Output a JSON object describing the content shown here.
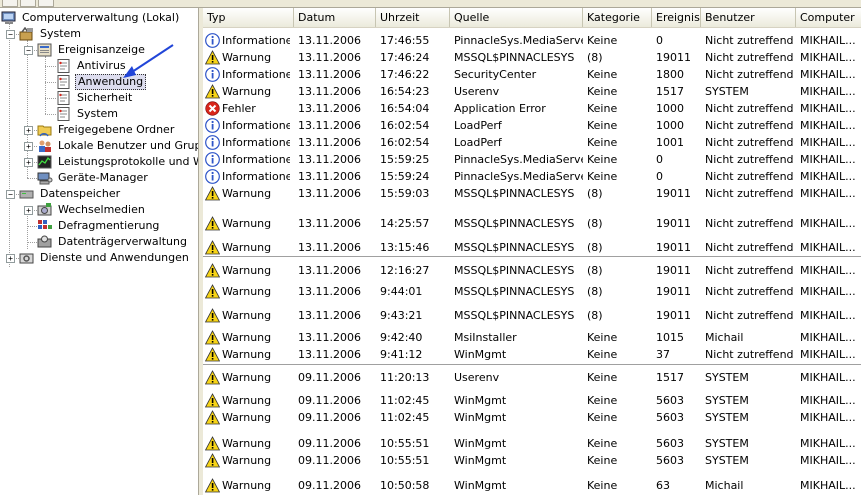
{
  "tree": {
    "root": {
      "label": "Computerverwaltung (Lokal)",
      "icon": "computer-management-icon"
    },
    "items": [
      {
        "label": "System",
        "icon": "system-tools-icon",
        "level": 1,
        "expander": "−"
      },
      {
        "label": "Ereignisanzeige",
        "icon": "event-viewer-icon",
        "level": 2,
        "expander": "−"
      },
      {
        "label": "Antivirus",
        "icon": "log-icon",
        "level": 3,
        "expander": ""
      },
      {
        "label": "Anwendung",
        "icon": "log-icon",
        "level": 3,
        "expander": "",
        "selected": true
      },
      {
        "label": "Sicherheit",
        "icon": "log-icon",
        "level": 3,
        "expander": ""
      },
      {
        "label": "System",
        "icon": "log-icon",
        "level": 3,
        "expander": ""
      },
      {
        "label": "Freigegebene Ordner",
        "icon": "shared-folder-icon",
        "level": 2,
        "expander": "+"
      },
      {
        "label": "Lokale Benutzer und Gruppen",
        "icon": "users-icon",
        "level": 2,
        "expander": "+"
      },
      {
        "label": "Leistungsprotokolle und Warnungen",
        "icon": "performance-icon",
        "level": 2,
        "expander": "+"
      },
      {
        "label": "Geräte-Manager",
        "icon": "device-manager-icon",
        "level": 2,
        "expander": ""
      },
      {
        "label": "Datenspeicher",
        "icon": "storage-icon",
        "level": 1,
        "expander": "−"
      },
      {
        "label": "Wechselmedien",
        "icon": "removable-media-icon",
        "level": 2,
        "expander": "+"
      },
      {
        "label": "Defragmentierung",
        "icon": "defrag-icon",
        "level": 2,
        "expander": ""
      },
      {
        "label": "Datenträgerverwaltung",
        "icon": "disk-management-icon",
        "level": 2,
        "expander": ""
      },
      {
        "label": "Dienste und Anwendungen",
        "icon": "services-icon",
        "level": 1,
        "expander": "+"
      }
    ]
  },
  "list": {
    "columns": [
      "Typ",
      "Datum",
      "Uhrzeit",
      "Quelle",
      "Kategorie",
      "Ereignis",
      "Benutzer",
      "Computer"
    ],
    "rows": [
      {
        "type": "info",
        "typ": "Informationen",
        "datum": "13.11.2006",
        "uhrzeit": "17:46:55",
        "quelle": "PinnacleSys.MediaServer",
        "kategorie": "Keine",
        "ereignis": "0",
        "benutzer": "Nicht zutreffend",
        "computer": "MIKHAIL..."
      },
      {
        "type": "warn",
        "typ": "Warnung",
        "datum": "13.11.2006",
        "uhrzeit": "17:46:24",
        "quelle": "MSSQL$PINNACLESYS",
        "kategorie": "(8)",
        "ereignis": "19011",
        "benutzer": "Nicht zutreffend",
        "computer": "MIKHAIL..."
      },
      {
        "type": "info",
        "typ": "Informationen",
        "datum": "13.11.2006",
        "uhrzeit": "17:46:22",
        "quelle": "SecurityCenter",
        "kategorie": "Keine",
        "ereignis": "1800",
        "benutzer": "Nicht zutreffend",
        "computer": "MIKHAIL..."
      },
      {
        "type": "warn",
        "typ": "Warnung",
        "datum": "13.11.2006",
        "uhrzeit": "16:54:23",
        "quelle": "Userenv",
        "kategorie": "Keine",
        "ereignis": "1517",
        "benutzer": "SYSTEM",
        "computer": "MIKHAIL..."
      },
      {
        "type": "error",
        "typ": "Fehler",
        "datum": "13.11.2006",
        "uhrzeit": "16:54:04",
        "quelle": "Application Error",
        "kategorie": "Keine",
        "ereignis": "1000",
        "benutzer": "Nicht zutreffend",
        "computer": "MIKHAIL..."
      },
      {
        "type": "info",
        "typ": "Informationen",
        "datum": "13.11.2006",
        "uhrzeit": "16:02:54",
        "quelle": "LoadPerf",
        "kategorie": "Keine",
        "ereignis": "1000",
        "benutzer": "Nicht zutreffend",
        "computer": "MIKHAIL..."
      },
      {
        "type": "info",
        "typ": "Informationen",
        "datum": "13.11.2006",
        "uhrzeit": "16:02:54",
        "quelle": "LoadPerf",
        "kategorie": "Keine",
        "ereignis": "1001",
        "benutzer": "Nicht zutreffend",
        "computer": "MIKHAIL..."
      },
      {
        "type": "info",
        "typ": "Informationen",
        "datum": "13.11.2006",
        "uhrzeit": "15:59:25",
        "quelle": "PinnacleSys.MediaServer",
        "kategorie": "Keine",
        "ereignis": "0",
        "benutzer": "Nicht zutreffend",
        "computer": "MIKHAIL..."
      },
      {
        "type": "info",
        "typ": "Informationen",
        "datum": "13.11.2006",
        "uhrzeit": "15:59:24",
        "quelle": "PinnacleSys.MediaServer",
        "kategorie": "Keine",
        "ereignis": "0",
        "benutzer": "Nicht zutreffend",
        "computer": "MIKHAIL..."
      },
      {
        "type": "warn",
        "typ": "Warnung",
        "datum": "13.11.2006",
        "uhrzeit": "15:59:03",
        "quelle": "MSSQL$PINNACLESYS",
        "kategorie": "(8)",
        "ereignis": "19011",
        "benutzer": "Nicht zutreffend",
        "computer": "MIKHAIL..."
      },
      {
        "type": "warn",
        "typ": "Warnung",
        "datum": "13.11.2006",
        "uhrzeit": "14:25:57",
        "quelle": "MSSQL$PINNACLESYS",
        "kategorie": "(8)",
        "ereignis": "19011",
        "benutzer": "Nicht zutreffend",
        "computer": "MIKHAIL..."
      },
      {
        "type": "warn",
        "typ": "Warnung",
        "datum": "13.11.2006",
        "uhrzeit": "13:15:46",
        "quelle": "MSSQL$PINNACLESYS",
        "kategorie": "(8)",
        "ereignis": "19011",
        "benutzer": "Nicht zutreffend",
        "computer": "MIKHAIL..."
      },
      {
        "type": "warn",
        "typ": "Warnung",
        "datum": "13.11.2006",
        "uhrzeit": "12:16:27",
        "quelle": "MSSQL$PINNACLESYS",
        "kategorie": "(8)",
        "ereignis": "19011",
        "benutzer": "Nicht zutreffend",
        "computer": "MIKHAIL..."
      },
      {
        "type": "warn",
        "typ": "Warnung",
        "datum": "13.11.2006",
        "uhrzeit": "9:44:01",
        "quelle": "MSSQL$PINNACLESYS",
        "kategorie": "(8)",
        "ereignis": "19011",
        "benutzer": "Nicht zutreffend",
        "computer": "MIKHAIL..."
      },
      {
        "type": "warn",
        "typ": "Warnung",
        "datum": "13.11.2006",
        "uhrzeit": "9:43:21",
        "quelle": "MSSQL$PINNACLESYS",
        "kategorie": "(8)",
        "ereignis": "19011",
        "benutzer": "Nicht zutreffend",
        "computer": "MIKHAIL..."
      },
      {
        "type": "warn",
        "typ": "Warnung",
        "datum": "13.11.2006",
        "uhrzeit": "9:42:40",
        "quelle": "MsiInstaller",
        "kategorie": "Keine",
        "ereignis": "1015",
        "benutzer": "Michail",
        "computer": "MIKHAIL..."
      },
      {
        "type": "warn",
        "typ": "Warnung",
        "datum": "13.11.2006",
        "uhrzeit": "9:41:12",
        "quelle": "WinMgmt",
        "kategorie": "Keine",
        "ereignis": "37",
        "benutzer": "Nicht zutreffend",
        "computer": "MIKHAIL..."
      },
      {
        "type": "warn",
        "typ": "Warnung",
        "datum": "09.11.2006",
        "uhrzeit": "11:20:13",
        "quelle": "Userenv",
        "kategorie": "Keine",
        "ereignis": "1517",
        "benutzer": "SYSTEM",
        "computer": "MIKHAIL..."
      },
      {
        "type": "warn",
        "typ": "Warnung",
        "datum": "09.11.2006",
        "uhrzeit": "11:02:45",
        "quelle": "WinMgmt",
        "kategorie": "Keine",
        "ereignis": "5603",
        "benutzer": "SYSTEM",
        "computer": "MIKHAIL..."
      },
      {
        "type": "warn",
        "typ": "Warnung",
        "datum": "09.11.2006",
        "uhrzeit": "11:02:45",
        "quelle": "WinMgmt",
        "kategorie": "Keine",
        "ereignis": "5603",
        "benutzer": "SYSTEM",
        "computer": "MIKHAIL..."
      },
      {
        "type": "warn",
        "typ": "Warnung",
        "datum": "09.11.2006",
        "uhrzeit": "10:55:51",
        "quelle": "WinMgmt",
        "kategorie": "Keine",
        "ereignis": "5603",
        "benutzer": "SYSTEM",
        "computer": "MIKHAIL..."
      },
      {
        "type": "warn",
        "typ": "Warnung",
        "datum": "09.11.2006",
        "uhrzeit": "10:55:51",
        "quelle": "WinMgmt",
        "kategorie": "Keine",
        "ereignis": "5603",
        "benutzer": "SYSTEM",
        "computer": "MIKHAIL..."
      },
      {
        "type": "warn",
        "typ": "Warnung",
        "datum": "09.11.2006",
        "uhrzeit": "10:50:58",
        "quelle": "WinMgmt",
        "kategorie": "Keine",
        "ereignis": "63",
        "benutzer": "Michail",
        "computer": "MIKHAIL..."
      }
    ]
  },
  "colors": {
    "arrow": "#2145d8",
    "warning": "#f7d417",
    "error": "#d8261b",
    "info": "#2f55c8"
  }
}
